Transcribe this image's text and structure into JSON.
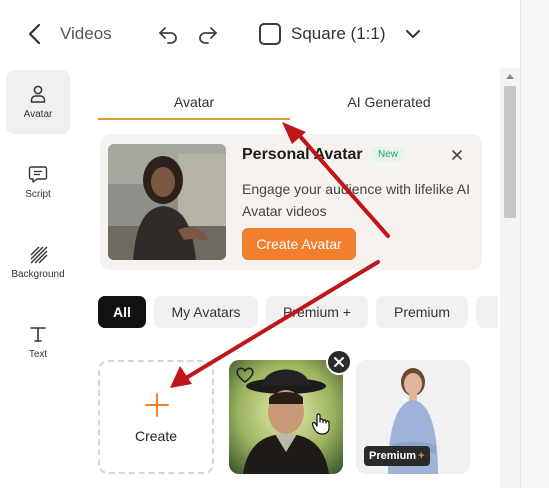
{
  "header": {
    "back_icon": "chevron-left-icon",
    "title": "Videos",
    "aspect_ratio": "Square (1:1)"
  },
  "sidenav": {
    "items": [
      {
        "label": "Avatar",
        "icon": "person-icon",
        "active": true
      },
      {
        "label": "Script",
        "icon": "chat-icon",
        "active": false
      },
      {
        "label": "Background",
        "icon": "stripes-icon",
        "active": false
      },
      {
        "label": "Text",
        "icon": "text-t-icon",
        "active": false
      }
    ]
  },
  "tabs": [
    {
      "label": "Avatar",
      "active": true
    },
    {
      "label": "AI Generated",
      "active": false
    }
  ],
  "promo": {
    "title": "Personal Avatar",
    "badge": "New",
    "description": "Engage your audience with lifelike AI Avatar videos",
    "button": "Create Avatar"
  },
  "filters": [
    "All",
    "My Avatars",
    "Premium +",
    "Premium"
  ],
  "active_filter": "All",
  "cards": {
    "create_label": "Create",
    "premium_badge": "Premium",
    "premium_badge_plus": "+"
  },
  "colors": {
    "accent": "#f27f2d",
    "tab_underline": "#d99a3a",
    "annotation_arrow": "#c0161a",
    "new_badge": "#2aa35a"
  }
}
